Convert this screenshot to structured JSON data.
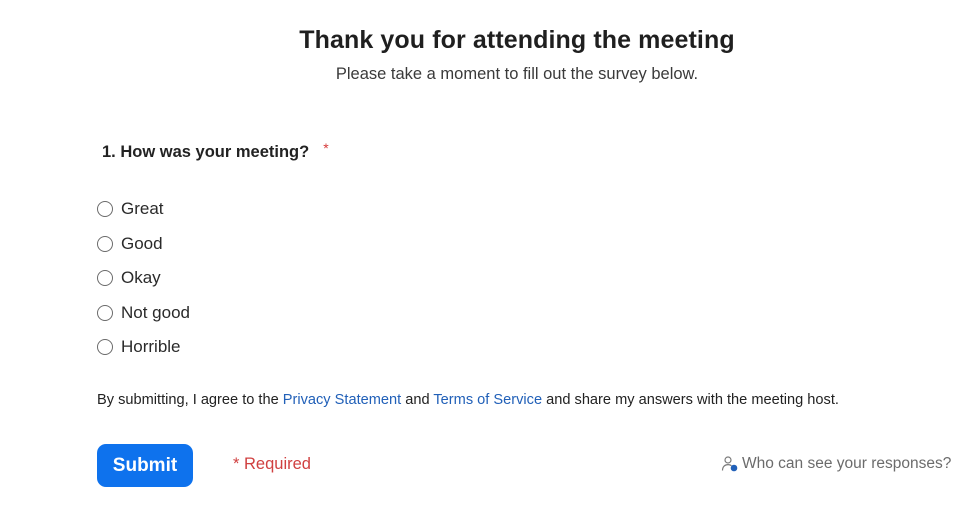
{
  "header": {
    "title": "Thank you for attending the meeting",
    "subtitle": "Please take a moment to fill out the survey below."
  },
  "question": {
    "text": "1. How was your meeting?",
    "required_marker": "*",
    "options": [
      {
        "label": "Great",
        "selected": false
      },
      {
        "label": "Good",
        "selected": false
      },
      {
        "label": "Okay",
        "selected": false
      },
      {
        "label": "Not good",
        "selected": false
      },
      {
        "label": "Horrible",
        "selected": false
      }
    ]
  },
  "consent": {
    "prefix": "By submitting, I agree to the ",
    "privacy_link": "Privacy Statement",
    "middle": " and ",
    "terms_link": "Terms of Service",
    "suffix": " and share my answers with the meeting host."
  },
  "footer": {
    "submit_label": "Submit",
    "required_note": "* Required",
    "who_can_see": "Who can see your responses?",
    "who_can_see_icon": "user-lock-icon"
  },
  "colors": {
    "accent": "#0e72ed",
    "link": "#2160b8",
    "required": "#d04040"
  }
}
